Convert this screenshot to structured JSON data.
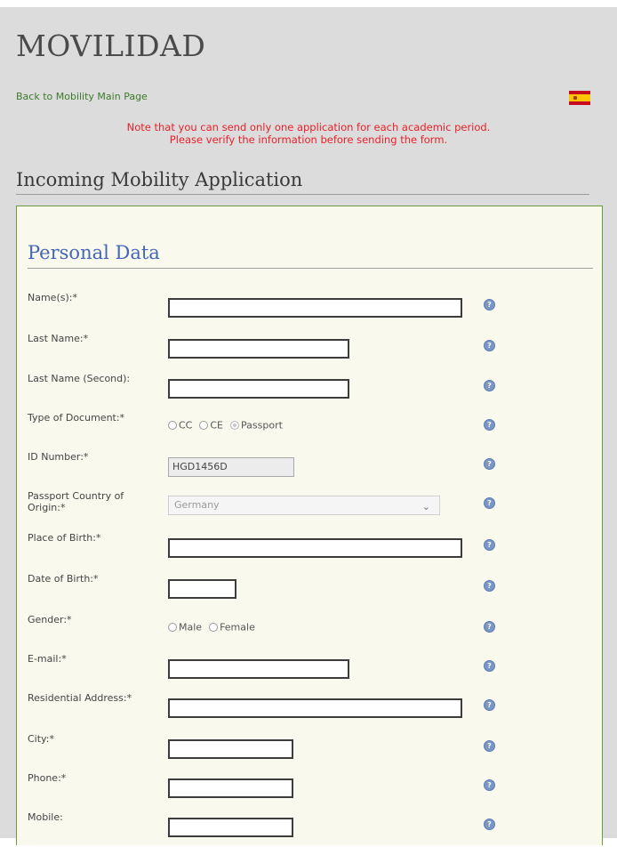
{
  "header": {
    "site_title": "MOVILIDAD",
    "back_link": "Back to Mobility Main Page",
    "language_flag": "spain-flag-icon"
  },
  "notice": {
    "line1": "Note that you can send only one application for each academic period.",
    "line2": "Please verify the information before sending the form."
  },
  "page": {
    "title": "Incoming Mobility Application"
  },
  "section": {
    "title": "Personal Data"
  },
  "colors": {
    "notice": "#e8202a",
    "link": "#3d7a2a",
    "panel_border": "#6e9a3f",
    "section_title": "#4466b8"
  },
  "form": {
    "name": {
      "label": "Name(s):*",
      "value": ""
    },
    "last_name": {
      "label": "Last Name:*",
      "value": ""
    },
    "last_name_second": {
      "label": "Last Name (Second):",
      "value": ""
    },
    "doc_type": {
      "label": "Type of Document:*",
      "options": [
        "CC",
        "CE",
        "Passport"
      ],
      "selected": "Passport"
    },
    "id_number": {
      "label": "ID Number:*",
      "value": "HGD1456D"
    },
    "passport_country": {
      "label": "Passport Country of Origin:*",
      "value": "Germany"
    },
    "place_of_birth": {
      "label": "Place of Birth:*",
      "value": ""
    },
    "date_of_birth": {
      "label": "Date of Birth:*",
      "value": ""
    },
    "gender": {
      "label": "Gender:*",
      "options": [
        "Male",
        "Female"
      ],
      "selected": ""
    },
    "email": {
      "label": "E-mail:*",
      "value": ""
    },
    "address": {
      "label": "Residential Address:*",
      "value": ""
    },
    "city": {
      "label": "City:*",
      "value": ""
    },
    "phone": {
      "label": "Phone:*",
      "value": ""
    },
    "mobile": {
      "label": "Mobile:",
      "value": ""
    }
  }
}
